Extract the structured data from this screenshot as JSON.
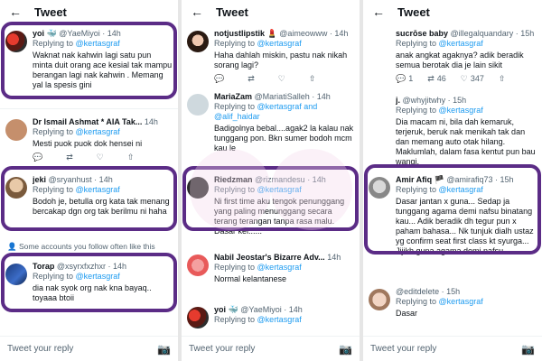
{
  "header_title": "Tweet",
  "reply_placeholder": "Tweet your reply",
  "replying_prefix": "Replying to",
  "replying_handle": "@kertasgraf",
  "replying_handle_2": "@kertasgraf and @alif_haidar",
  "follow_note": "Some accounts you follow often like this",
  "col1": [
    {
      "name": "yoi 🐳",
      "handle": "@YaeMiyoi · 14h",
      "text": "Waknat nak kahwin lagi satu pun minta duit orang ace kesial tak mampu berangan lagi nak kahwin . Memang yal la spesis gini"
    },
    {
      "name": "Dr Ismail Ashmat * AIA Tak...",
      "handle": "14h",
      "text": "Mesti puok puok dok hensei ni"
    },
    {
      "name": "jeki",
      "handle": "@sryanhust · 14h",
      "text": "Bodoh je, betulla org kata tak menang bercakap dgn org tak berilmu ni haha"
    },
    {
      "name": "Torap",
      "handle": "@xsyrxfxzhxr · 14h",
      "text": "dia nak syok org nak kna bayaq.. toyaaa btoii"
    }
  ],
  "col2": [
    {
      "name": "notjustlipstik 💄",
      "handle": "@aimeowww · 14h",
      "text": "Haha dahlah miskin, pastu nak nikah sorang lagi?"
    },
    {
      "name": "MariaZam",
      "handle": "@MariatiSalleh · 14h",
      "text": "Badigolnya bebal....agak2 la kalau nak tunggang pon. Bkn sumer bodoh mcm kau le"
    },
    {
      "name": "Riedzman",
      "handle": "@rizmandesu · 14h",
      "text": "Ni first time aku tengok penunggang yang paling menunggang secara terang terangan tanpa rasa malu. Dasar kel......"
    },
    {
      "name": "Nabil Jeostar's Bizarre Adv...",
      "handle": "14h",
      "text": "Normal kelantanese"
    },
    {
      "name": "yoi 🐳",
      "handle": "@YaeMiyoi · 14h",
      "text": ""
    }
  ],
  "col3": [
    {
      "name": "sucrōse baby",
      "handle": "@illegalquandary · 15h",
      "text": "anak angkat agaknya? adik beradik semua berotak dia je lain sikit",
      "stats": [
        "1",
        "46",
        "347"
      ]
    },
    {
      "name": "j.",
      "handle": "@whyjitwhy · 15h",
      "text": "Dia macam ni, bila dah kemaruk, terjeruk, beruk nak menikah tak dan dan memang auto otak hilang. Maklumlah, dalam fasa kentut pun bau wangi."
    },
    {
      "name": "Amir Afiq 🏴",
      "handle": "@amirafiq73 · 15h",
      "text": "Dasar jantan x guna... Sedap ja tunggang agama demi nafsu binatang kau... Adik beradik dh tegur pun x paham bahasa... Nk tunjuk dialh ustaz yg confirm seat first class kt syurga... Jijikh guna agama demi nafsu"
    },
    {
      "name": "",
      "handle": "@editdelete · 15h",
      "text": "Dasar"
    }
  ],
  "colors": {
    "highlight": "#5b2c86",
    "accent": "#1d9bf0",
    "muted": "#536471"
  }
}
